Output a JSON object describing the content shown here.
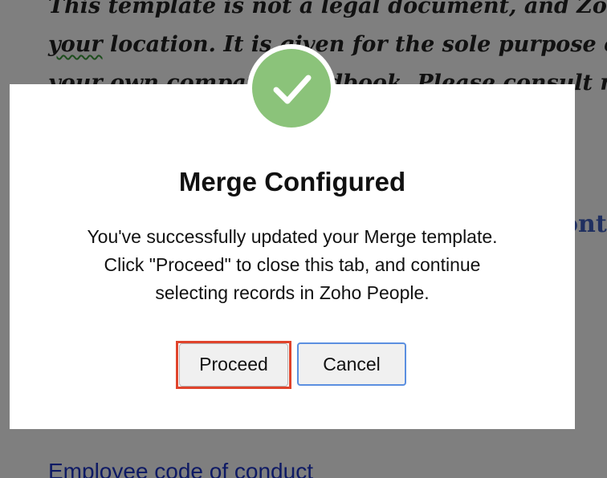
{
  "background_document": {
    "line1": "This template is not a legal document, and Zoho",
    "line2_squiggle": "your",
    "line2_rest": " location. It is given for the sole purpose of pr",
    "line3": "your own company handbook. Please consult rele",
    "heading_fragment": "ont",
    "link_text": "Employee code of conduct"
  },
  "dialog": {
    "icon": "check-icon",
    "icon_color": "#8bc37a",
    "title": "Merge Configured",
    "message_lines": [
      "You've successfully updated your Merge template.",
      "Click \"Proceed\" to close this tab, and continue",
      "selecting records in Zoho People."
    ],
    "proceed_label": "Proceed",
    "cancel_label": "Cancel"
  },
  "colors": {
    "overlay": "rgba(0,0,0,0.5)",
    "highlight_border": "#e0442c",
    "cancel_focus_border": "#5b8fe0",
    "link": "#1d35c9"
  }
}
